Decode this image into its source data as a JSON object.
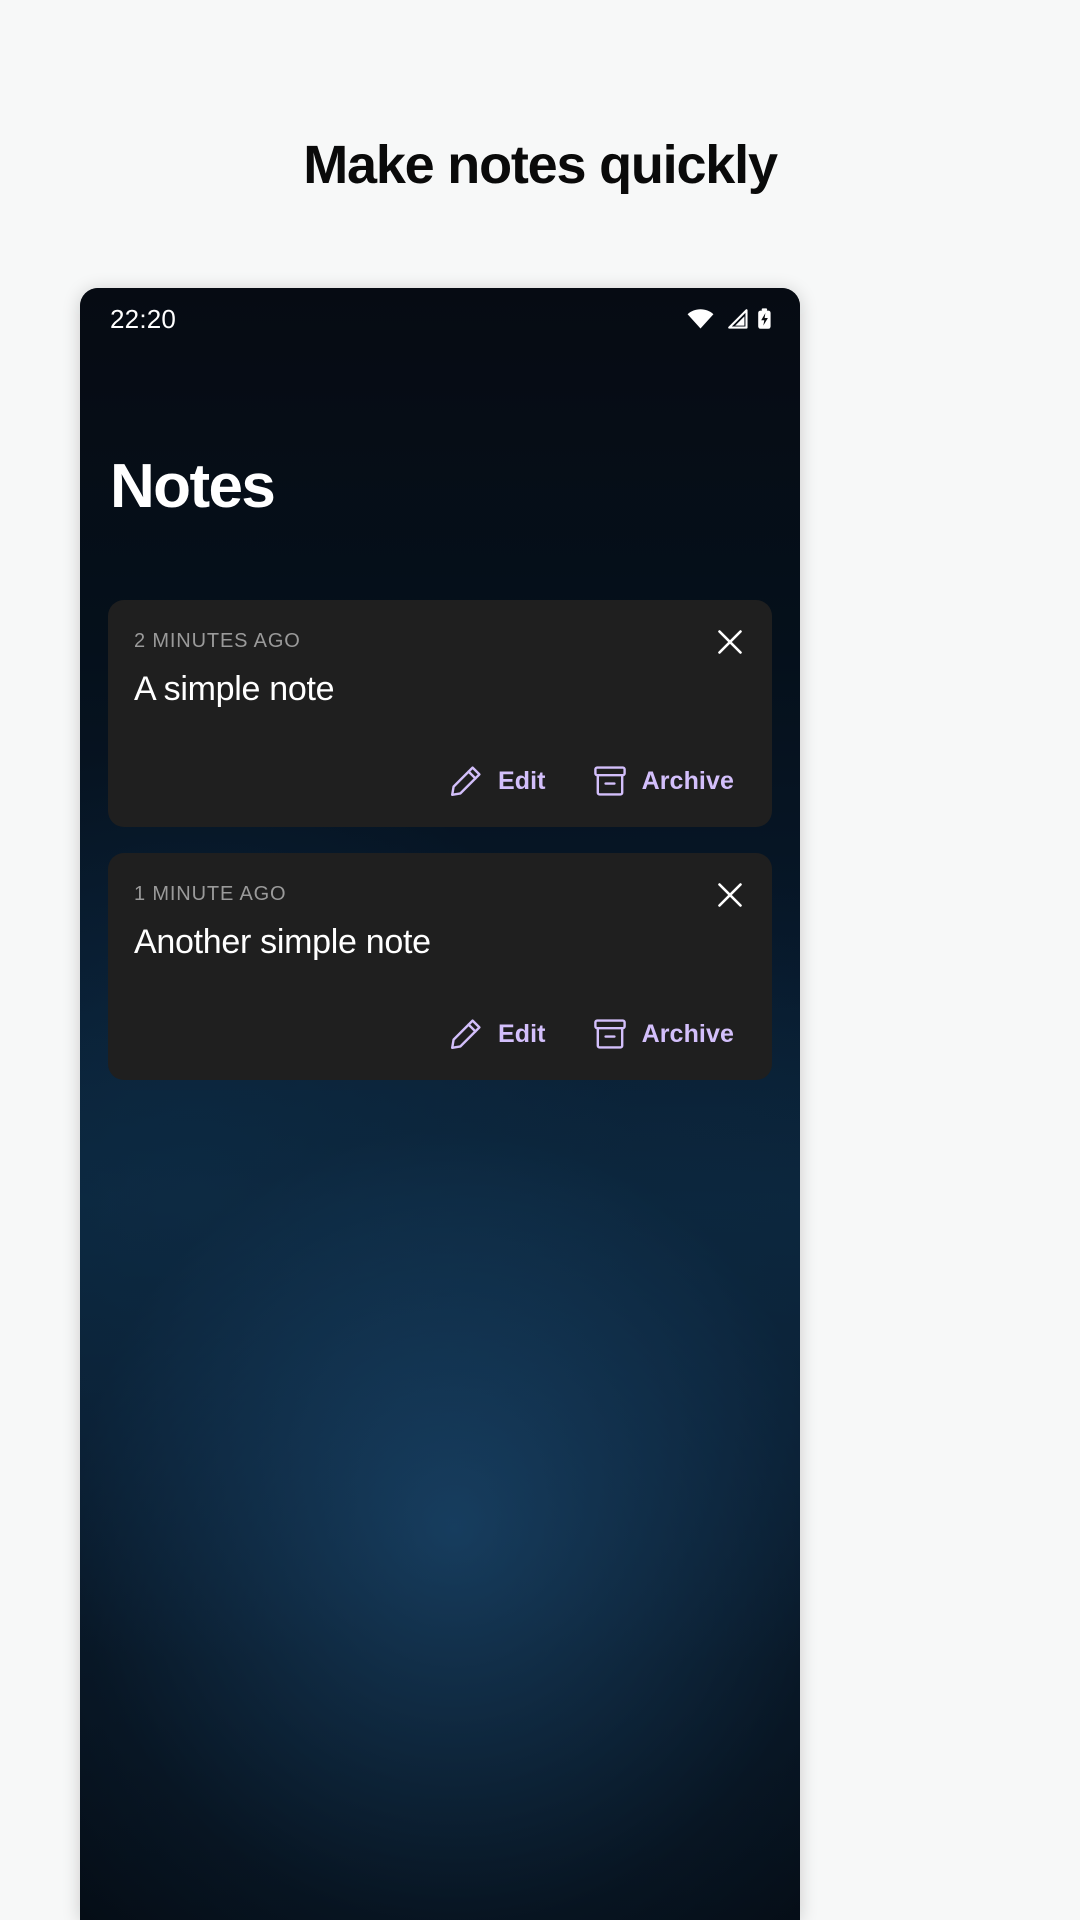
{
  "headline": "Make notes quickly",
  "colors": {
    "page_background": "#F7F8F8",
    "headline_text": "#0A0A0A",
    "phone_background": "#05101B",
    "card_background": "#1F1F1F",
    "accent": "#D3BFFB",
    "meta_text": "#9A9A9A",
    "title_text": "#FFFFFF"
  },
  "phone": {
    "statusbar": {
      "clock": "22:20",
      "icons": [
        "wifi-icon",
        "cellular-signal-icon",
        "battery-charging-icon"
      ]
    },
    "app_title": "Notes",
    "close_icon_name": "close-icon",
    "notes": [
      {
        "meta": "2 MINUTES AGO",
        "title": "A simple note",
        "actions": [
          {
            "icon": "pencil-icon",
            "label": "Edit"
          },
          {
            "icon": "archive-icon",
            "label": "Archive"
          }
        ]
      },
      {
        "meta": "1 MINUTE AGO",
        "title": "Another simple note",
        "actions": [
          {
            "icon": "pencil-icon",
            "label": "Edit"
          },
          {
            "icon": "archive-icon",
            "label": "Archive"
          }
        ]
      }
    ]
  }
}
